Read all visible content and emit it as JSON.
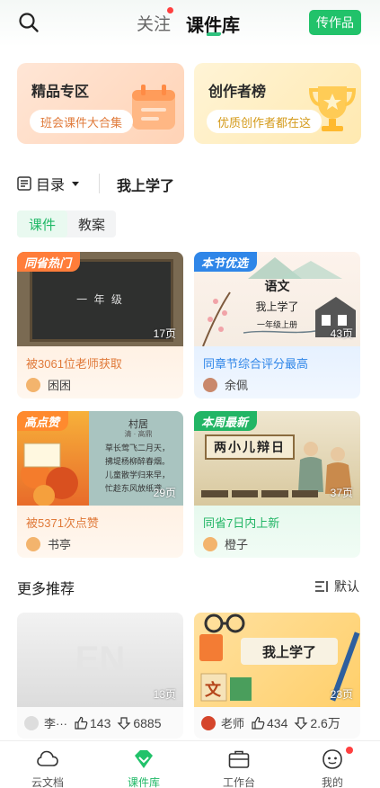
{
  "header": {
    "search_icon": "search-icon",
    "tab_follow": "关注",
    "tab_courseware": "课件库",
    "publish_button": "传作品",
    "accent": "#21c26a"
  },
  "promos": [
    {
      "title": "精品专区",
      "pill": "班会课件大合集"
    },
    {
      "title": "创作者榜",
      "pill": "优质创作者都在这"
    }
  ],
  "directory": {
    "label": "目录",
    "current": "我上学了"
  },
  "subtabs": [
    "课件",
    "教案"
  ],
  "cards": [
    {
      "badge": "同省热门",
      "pages": "17页",
      "desc": "被3061位老师获取",
      "author": "困困",
      "thumb_text": "一  年  级"
    },
    {
      "badge": "本节优选",
      "pages": "43页",
      "desc": "同章节综合评分最高",
      "author": "余佩",
      "thumb_title": "语文",
      "thumb_sub": "我上学了",
      "thumb_grade": "一年级上册"
    },
    {
      "badge": "高点赞",
      "pages": "29页",
      "desc": "被5371次点赞",
      "author": "书亭",
      "thumb_poem_title": "村居",
      "thumb_poem_author": "清 · 高鼎",
      "thumb_poem": [
        "草长莺飞二月天，",
        "拂堤杨柳醉春烟。",
        "儿童散学归来早，",
        "忙趁东风放纸鸢。"
      ]
    },
    {
      "badge": "本周最新",
      "pages": "37页",
      "desc": "同省7日内上新",
      "author": "橙子",
      "thumb_title": "两小儿辩日"
    }
  ],
  "more": {
    "title": "更多推荐",
    "sort_label": "默认"
  },
  "recommend": [
    {
      "pages": "13页",
      "author": "李···",
      "likes": "143",
      "downloads": "6885",
      "thumb_text": "EN"
    },
    {
      "pages": "23页",
      "author": "老师",
      "likes": "434",
      "downloads": "2.6万",
      "thumb_title": "我上学了",
      "thumb_char": "文"
    }
  ],
  "nav": [
    {
      "label": "云文档",
      "icon": "cloud-icon"
    },
    {
      "label": "课件库",
      "icon": "courseware-icon"
    },
    {
      "label": "工作台",
      "icon": "briefcase-icon"
    },
    {
      "label": "我的",
      "icon": "profile-icon"
    }
  ]
}
